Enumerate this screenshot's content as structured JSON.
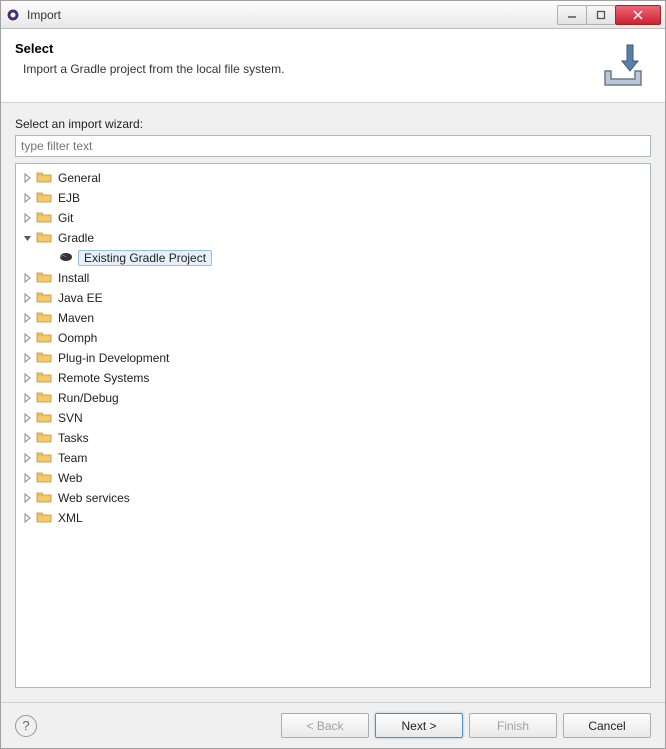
{
  "window": {
    "title": "Import"
  },
  "header": {
    "title": "Select",
    "description": "Import a Gradle project from the local file system."
  },
  "body": {
    "wizard_label": "Select an import wizard:",
    "filter_placeholder": "type filter text"
  },
  "tree": {
    "items": [
      {
        "label": "General",
        "expanded": false
      },
      {
        "label": "EJB",
        "expanded": false
      },
      {
        "label": "Git",
        "expanded": false
      },
      {
        "label": "Gradle",
        "expanded": true,
        "children": [
          {
            "label": "Existing Gradle Project",
            "selected": true
          }
        ]
      },
      {
        "label": "Install",
        "expanded": false
      },
      {
        "label": "Java EE",
        "expanded": false
      },
      {
        "label": "Maven",
        "expanded": false
      },
      {
        "label": "Oomph",
        "expanded": false
      },
      {
        "label": "Plug-in Development",
        "expanded": false
      },
      {
        "label": "Remote Systems",
        "expanded": false
      },
      {
        "label": "Run/Debug",
        "expanded": false
      },
      {
        "label": "SVN",
        "expanded": false
      },
      {
        "label": "Tasks",
        "expanded": false
      },
      {
        "label": "Team",
        "expanded": false
      },
      {
        "label": "Web",
        "expanded": false
      },
      {
        "label": "Web services",
        "expanded": false
      },
      {
        "label": "XML",
        "expanded": false
      }
    ]
  },
  "buttons": {
    "back": "< Back",
    "next": "Next >",
    "finish": "Finish",
    "cancel": "Cancel"
  }
}
